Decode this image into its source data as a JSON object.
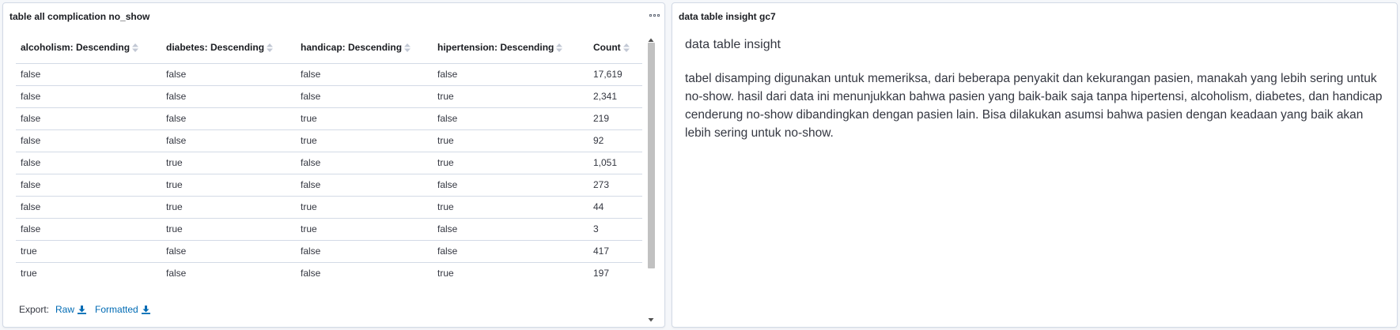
{
  "left_panel": {
    "title": "table all complication no_show",
    "table": {
      "headers": [
        "alcoholism: Descending",
        "diabetes: Descending",
        "handicap: Descending",
        "hipertension: Descending",
        "Count"
      ],
      "rows": [
        [
          "false",
          "false",
          "false",
          "false",
          "17,619"
        ],
        [
          "false",
          "false",
          "false",
          "true",
          "2,341"
        ],
        [
          "false",
          "false",
          "true",
          "false",
          "219"
        ],
        [
          "false",
          "false",
          "true",
          "true",
          "92"
        ],
        [
          "false",
          "true",
          "false",
          "true",
          "1,051"
        ],
        [
          "false",
          "true",
          "false",
          "false",
          "273"
        ],
        [
          "false",
          "true",
          "true",
          "true",
          "44"
        ],
        [
          "false",
          "true",
          "true",
          "false",
          "3"
        ],
        [
          "true",
          "false",
          "false",
          "false",
          "417"
        ],
        [
          "true",
          "false",
          "false",
          "true",
          "197"
        ]
      ]
    },
    "export": {
      "label": "Export:",
      "raw_label": "Raw",
      "formatted_label": "Formatted"
    }
  },
  "right_panel": {
    "title": "data table insight gc7",
    "heading": "data table insight",
    "body": "tabel disamping digunakan untuk memeriksa, dari beberapa penyakit dan kekurangan pasien, manakah yang lebih sering untuk no-show. hasil dari data ini menunjukkan bahwa pasien yang baik-baik saja tanpa hipertensi, alcoholism, diabetes, dan handicap cenderung no-show dibandingkan dengan pasien lain. Bisa dilakukan asumsi bahwa pasien dengan keadaan yang baik akan lebih sering untuk no-show."
  },
  "colors": {
    "link": "#006bb4",
    "border": "#d3dae6",
    "text": "#343741",
    "background": "#f5f7fa"
  },
  "icons": {
    "sort": "sort-icon",
    "download": "download-icon",
    "panel_options": "panel-options-icon"
  }
}
